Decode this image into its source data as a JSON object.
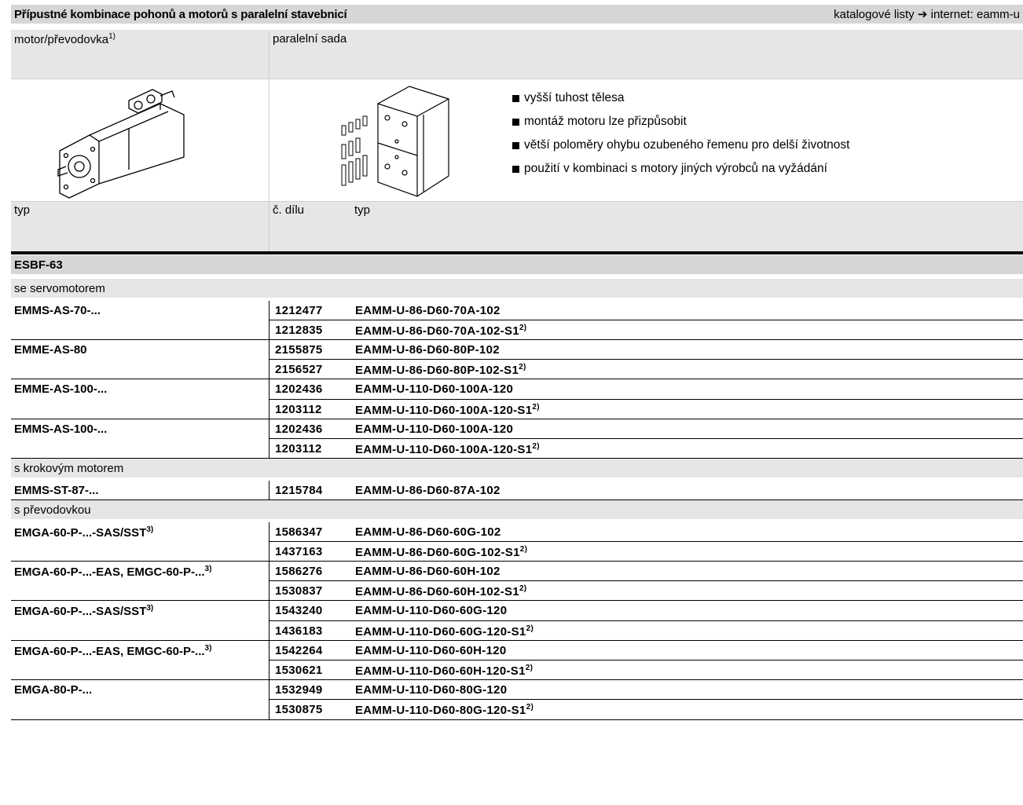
{
  "title": "Přípustné kombinace pohonů a motorů s paralelní stavebnicí",
  "title_right_prefix": "katalogové listy",
  "title_right_arrow": "➔",
  "title_right_suffix": "internet: eamm-u",
  "header": {
    "col1": "motor/převodovka",
    "col1_sup": "1)",
    "col2": "paralelní sada",
    "typ": "typ",
    "part_no": "č. dílu",
    "typ2": "typ"
  },
  "bullets": [
    "vyšší tuhost tělesa",
    "montáž motoru lze přizpůsobit",
    "větší poloměry ohybu ozubeného řemenu pro delší životnost",
    "použití v kombinaci s motory jiných výrobců na vyžádání"
  ],
  "section": "ESBF-63",
  "groups": [
    {
      "label": "se servomotorem",
      "motors": [
        {
          "name": "EMMS-AS-70-...",
          "rows": [
            {
              "num": "1212477",
              "type": "EAMM-U-86-D60-70A-102",
              "sup": ""
            },
            {
              "num": "1212835",
              "type": "EAMM-U-86-D60-70A-102-S1",
              "sup": "2)"
            }
          ]
        },
        {
          "name": "EMME-AS-80",
          "rows": [
            {
              "num": "2155875",
              "type": "EAMM-U-86-D60-80P-102",
              "sup": ""
            },
            {
              "num": "2156527",
              "type": "EAMM-U-86-D60-80P-102-S1",
              "sup": "2)"
            }
          ]
        },
        {
          "name": "EMME-AS-100-...",
          "rows": [
            {
              "num": "1202436",
              "type": "EAMM-U-110-D60-100A-120",
              "sup": ""
            },
            {
              "num": "1203112",
              "type": "EAMM-U-110-D60-100A-120-S1",
              "sup": "2)"
            }
          ]
        },
        {
          "name": "EMMS-AS-100-...",
          "rows": [
            {
              "num": "1202436",
              "type": "EAMM-U-110-D60-100A-120",
              "sup": ""
            },
            {
              "num": "1203112",
              "type": "EAMM-U-110-D60-100A-120-S1",
              "sup": "2)"
            }
          ]
        }
      ]
    },
    {
      "label": "s krokovým motorem",
      "motors": [
        {
          "name": "EMMS-ST-87-...",
          "rows": [
            {
              "num": "1215784",
              "type": "EAMM-U-86-D60-87A-102",
              "sup": ""
            }
          ]
        }
      ]
    },
    {
      "label": "s převodovkou",
      "motors": [
        {
          "name": "EMGA-60-P-...-SAS/SST",
          "sup": "3)",
          "rows": [
            {
              "num": "1586347",
              "type": "EAMM-U-86-D60-60G-102",
              "sup": ""
            },
            {
              "num": "1437163",
              "type": "EAMM-U-86-D60-60G-102-S1",
              "sup": "2)"
            }
          ]
        },
        {
          "name": "EMGA-60-P-...-EAS, EMGC-60-P-...",
          "sup": "3)",
          "rows": [
            {
              "num": "1586276",
              "type": "EAMM-U-86-D60-60H-102",
              "sup": ""
            },
            {
              "num": "1530837",
              "type": "EAMM-U-86-D60-60H-102-S1",
              "sup": "2)"
            }
          ]
        },
        {
          "name": "EMGA-60-P-...-SAS/SST",
          "sup": "3)",
          "rows": [
            {
              "num": "1543240",
              "type": "EAMM-U-110-D60-60G-120",
              "sup": ""
            },
            {
              "num": "1436183",
              "type": "EAMM-U-110-D60-60G-120-S1",
              "sup": "2)"
            }
          ]
        },
        {
          "name": "EMGA-60-P-...-EAS, EMGC-60-P-...",
          "sup": "3)",
          "rows": [
            {
              "num": "1542264",
              "type": "EAMM-U-110-D60-60H-120",
              "sup": ""
            },
            {
              "num": "1530621",
              "type": "EAMM-U-110-D60-60H-120-S1",
              "sup": "2)"
            }
          ]
        },
        {
          "name": "EMGA-80-P-...",
          "rows": [
            {
              "num": "1532949",
              "type": "EAMM-U-110-D60-80G-120",
              "sup": ""
            },
            {
              "num": "1530875",
              "type": "EAMM-U-110-D60-80G-120-S1",
              "sup": "2)"
            }
          ]
        }
      ]
    }
  ]
}
